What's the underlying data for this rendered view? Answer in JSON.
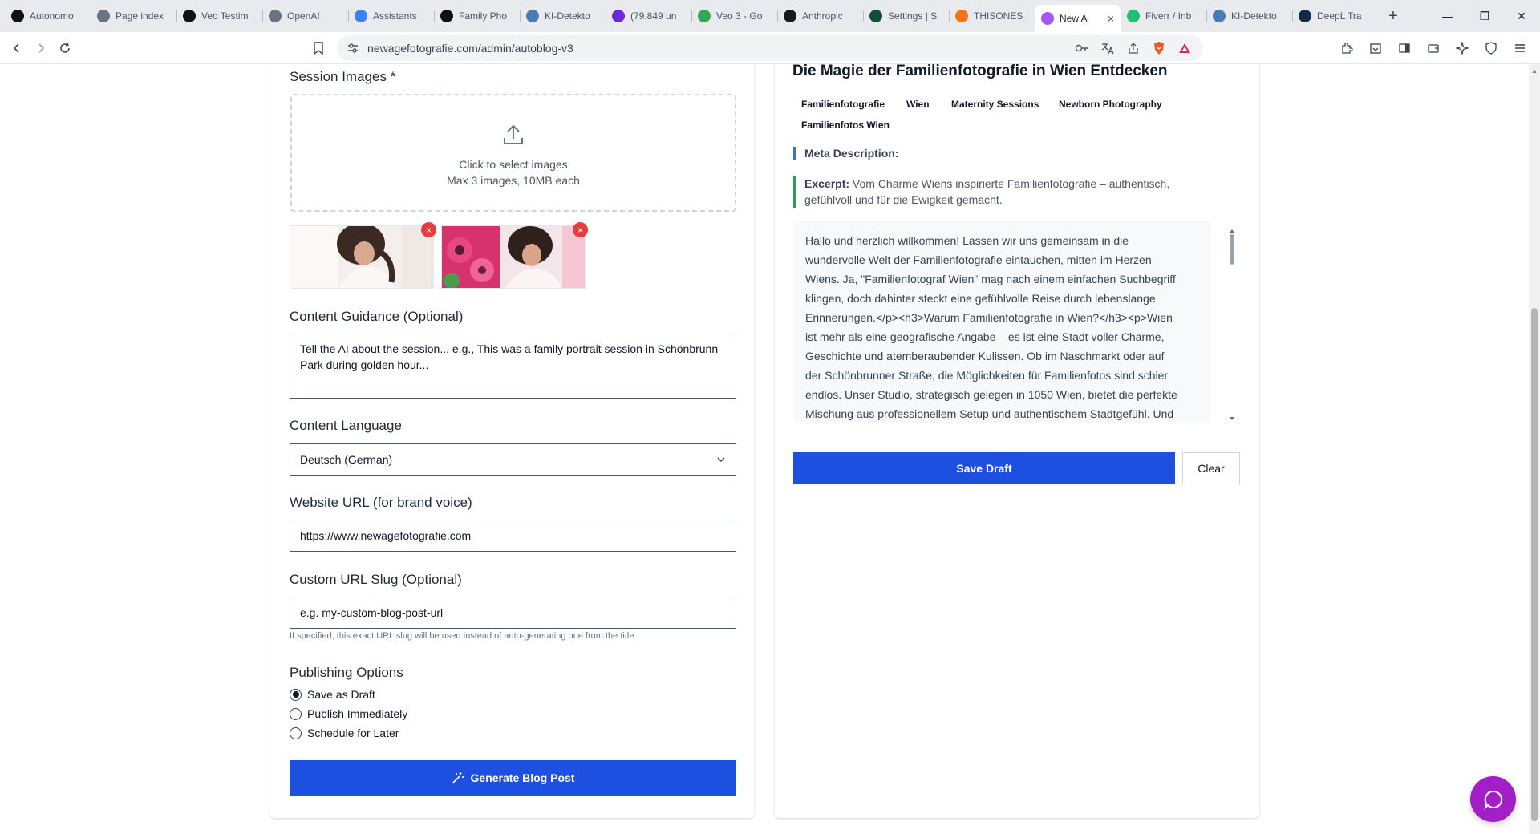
{
  "browser": {
    "tabs": [
      {
        "title": "Autonomo",
        "icon": "openai-icon",
        "color": "#111111"
      },
      {
        "title": "Page index",
        "icon": "page-index-icon",
        "color": "#6b7280"
      },
      {
        "title": "Veo Testim",
        "icon": "openai-icon",
        "color": "#111111"
      },
      {
        "title": "OpenAI",
        "icon": "openai-icon",
        "color": "#6b7280"
      },
      {
        "title": "Assistants",
        "icon": "assistants-icon",
        "color": "#3b82f6"
      },
      {
        "title": "Family Pho",
        "icon": "openai-icon",
        "color": "#111111"
      },
      {
        "title": "KI-Detekto",
        "icon": "ki-detektor-icon",
        "color": "#4b7bb5"
      },
      {
        "title": "(79,849 un",
        "icon": "mail-icon",
        "color": "#6d28d9"
      },
      {
        "title": "Veo 3 - Go",
        "icon": "google-drive-icon",
        "color": "#34a853"
      },
      {
        "title": "Anthropic",
        "icon": "anthropic-icon",
        "color": "#191919"
      },
      {
        "title": "Settings | S",
        "icon": "settings-site-icon",
        "color": "#0f5132"
      },
      {
        "title": "THISONES",
        "icon": "thisones-icon",
        "color": "#f97316"
      },
      {
        "title": "New A",
        "icon": "new-tab-site-icon",
        "color": "#a855f7",
        "active": true
      },
      {
        "title": "Fiverr / Inb",
        "icon": "fiverr-icon",
        "color": "#1dbf73"
      },
      {
        "title": "KI-Detekto",
        "icon": "ki-detektor-icon",
        "color": "#4b7bb5"
      },
      {
        "title": "DeepL Tra",
        "icon": "deepl-icon",
        "color": "#0f2b46"
      }
    ],
    "url": "newagefotografie.com/admin/autoblog-v3"
  },
  "form": {
    "session_images_label": "Session Images *",
    "dropzone_line1": "Click to select images",
    "dropzone_line2": "Max 3 images, 10MB each",
    "remove_symbol": "×",
    "content_guidance_label": "Content Guidance (Optional)",
    "content_guidance_placeholder": "Tell the AI about the session... e.g., This was a family portrait session in Schönbrunn Park during golden hour...",
    "content_language_label": "Content Language",
    "content_language_value": "Deutsch (German)",
    "website_url_label": "Website URL (for brand voice)",
    "website_url_value": "https://www.newagefotografie.com",
    "custom_slug_label": "Custom URL Slug (Optional)",
    "custom_slug_placeholder": "e.g. my-custom-blog-post-url",
    "custom_slug_hint": "If specified, this exact URL slug will be used instead of auto-generating one from the title",
    "publishing_label": "Publishing Options",
    "publishing_options": [
      {
        "label": "Save as Draft",
        "selected": true
      },
      {
        "label": "Publish Immediately",
        "selected": false
      },
      {
        "label": "Schedule for Later",
        "selected": false
      }
    ],
    "generate_label": "Generate Blog Post"
  },
  "preview": {
    "title": "Die Magie der Familienfotografie in Wien Entdecken",
    "tags": [
      "Familienfotografie",
      "Wien",
      "Maternity Sessions",
      "Newborn Photography",
      "Familienfotos Wien"
    ],
    "meta_label": "Meta Description:",
    "excerpt_label": "Excerpt:",
    "excerpt_text": "Vom Charme Wiens inspirierte Familienfotografie – authentisch, gefühlvoll und für die Ewigkeit gemacht.",
    "content_lines": [
      "Hallo und herzlich willkommen! Lassen wir uns gemeinsam in die",
      "wundervolle Welt der Familienfotografie eintauchen, mitten im Herzen",
      "Wiens. Ja, \"Familienfotograf Wien\" mag nach einem einfachen Suchbegriff",
      "klingen, doch dahinter steckt eine gefühlvolle Reise durch lebenslange",
      "Erinnerungen.</p><h3>Warum Familienfotografie in Wien?</h3><p>Wien",
      "ist mehr als eine geografische Angabe – es ist eine Stadt voller Charme,",
      "Geschichte und atemberaubender Kulissen. Ob im Naschmarkt oder auf",
      "der Schönbrunner Straße, die Möglichkeiten für Familienfotos sind schier",
      "endlos. Unser Studio, strategisch gelegen in 1050 Wien, bietet die perfekte",
      "Mischung aus professionellem Setup und authentischem Stadtgefühl. Und"
    ],
    "save_draft_label": "Save Draft",
    "clear_label": "Clear"
  },
  "colors": {
    "primary": "#1d4fe0",
    "remove": "#e53e3e",
    "meta_border": "#3b6fd4",
    "excerpt_border": "#22a55a",
    "chat": "#a21fc7"
  }
}
